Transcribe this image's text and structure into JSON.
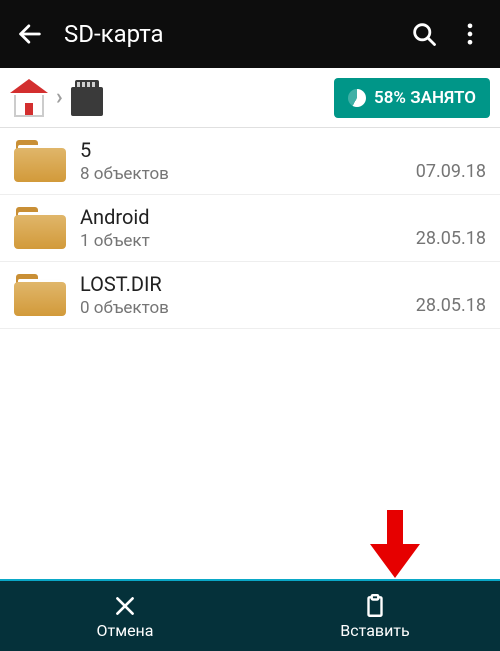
{
  "appbar": {
    "title": "SD-карта"
  },
  "path": {
    "storage_label": "58% ЗАНЯТО"
  },
  "files": [
    {
      "name": "5",
      "sub": "8 объектов",
      "date": "07.09.18"
    },
    {
      "name": "Android",
      "sub": "1 объект",
      "date": "28.05.18"
    },
    {
      "name": "LOST.DIR",
      "sub": "0 объектов",
      "date": "28.05.18"
    }
  ],
  "bottom": {
    "cancel": "Отмена",
    "paste": "Вставить"
  }
}
